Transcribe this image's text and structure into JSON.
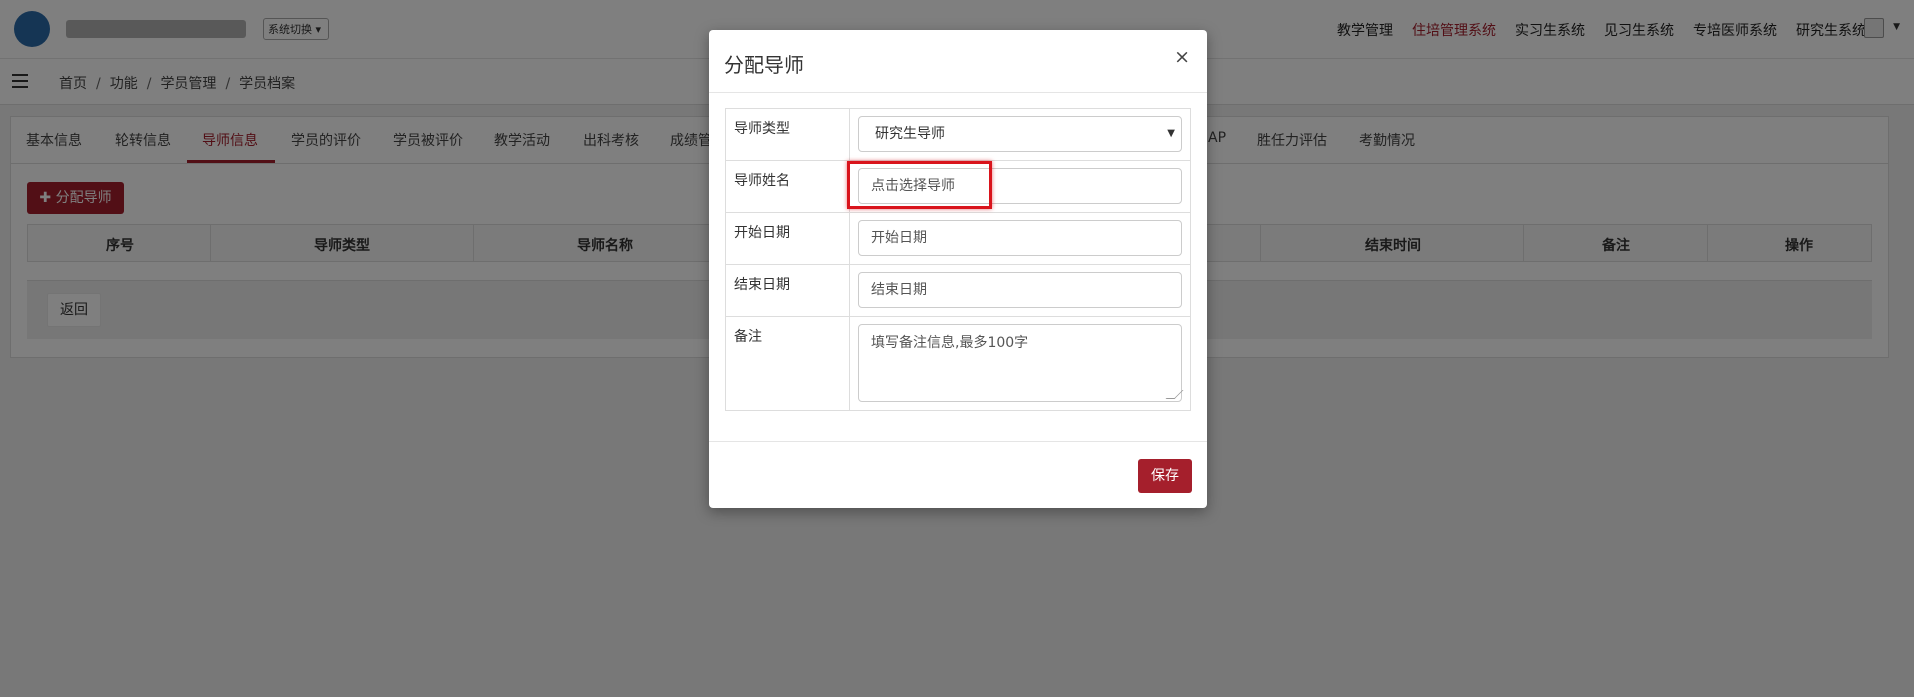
{
  "header": {
    "system_switch": "系统切换",
    "nav": [
      "教学管理",
      "住培管理系统",
      "实习生系统",
      "见习生系统",
      "专培医师系统",
      "研究生系统"
    ],
    "active_nav_index": 1
  },
  "breadcrumb": [
    "首页",
    "功能",
    "学员管理",
    "学员档案"
  ],
  "tabs": {
    "items": [
      "基本信息",
      "轮转信息",
      "导师信息",
      "学员的评价",
      "学员被评价",
      "教学活动",
      "出科考核",
      "成绩管",
      "AP",
      "胜任力评估",
      "考勤情况"
    ],
    "active_index": 2
  },
  "toolbar": {
    "assign_icon": "plus-icon",
    "assign_label": "分配导师"
  },
  "table": {
    "columns": [
      "序号",
      "导师类型",
      "导师名称",
      "结束时间",
      "备注",
      "操作"
    ]
  },
  "back_label": "返回",
  "modal": {
    "title": "分配导师",
    "close": "×",
    "fields": {
      "type_label": "导师类型",
      "type_value": "研究生导师",
      "name_label": "导师姓名",
      "name_placeholder": "点击选择导师",
      "start_label": "开始日期",
      "start_placeholder": "开始日期",
      "end_label": "结束日期",
      "end_placeholder": "结束日期",
      "remark_label": "备注",
      "remark_placeholder": "填写备注信息,最多100字"
    },
    "save_label": "保存"
  },
  "colors": {
    "brand": "#a51f2c",
    "highlight": "#d9141c"
  }
}
